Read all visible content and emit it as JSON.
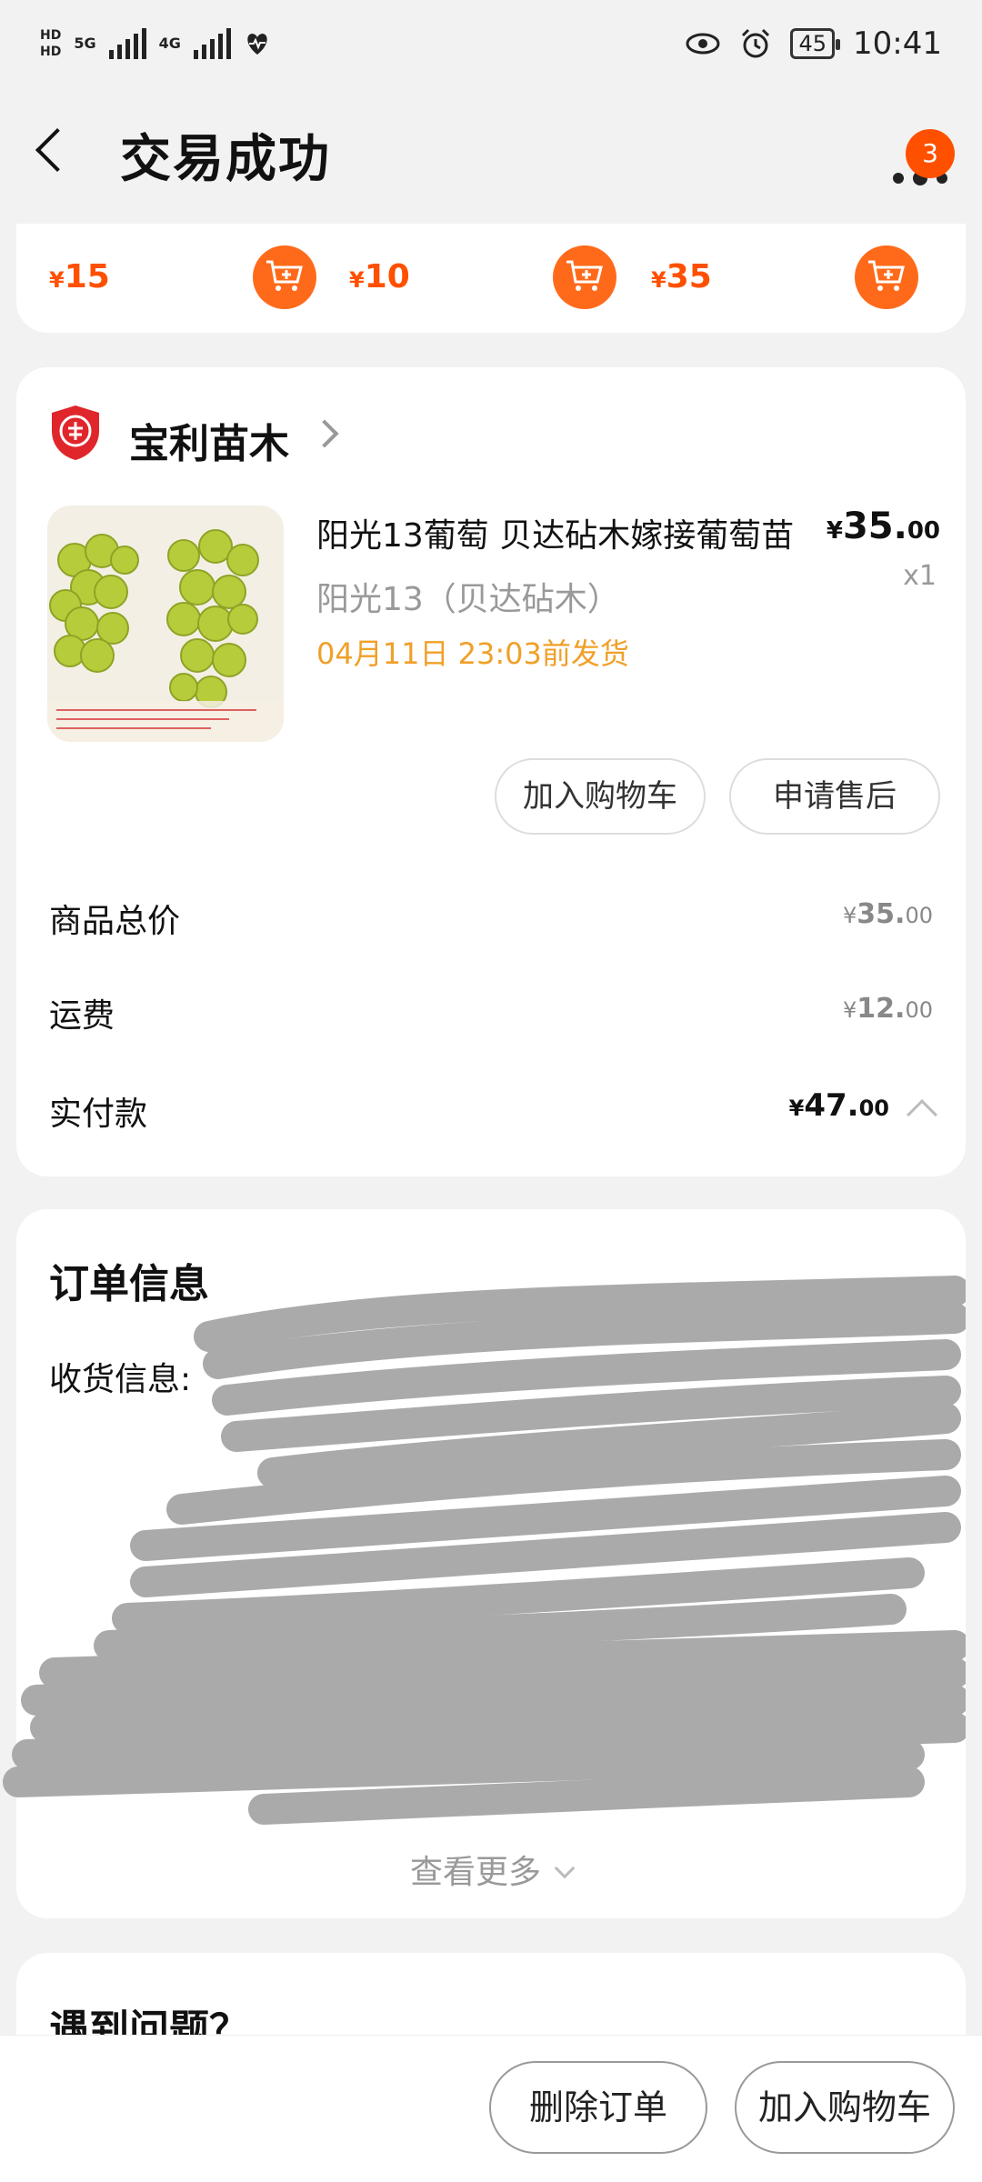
{
  "status_bar": {
    "network_5g": "5G",
    "network_4g": "4G",
    "battery": "45",
    "time": "10:41"
  },
  "header": {
    "title": "交易成功",
    "badge_count": "3"
  },
  "recommendations": [
    {
      "currency": "¥",
      "price": "15"
    },
    {
      "currency": "¥",
      "price": "10"
    },
    {
      "currency": "¥",
      "price": "35"
    }
  ],
  "order": {
    "shop_name": "宝利苗木",
    "product": {
      "title": "阳光13葡萄  贝达砧木嫁接葡萄苗",
      "price_currency": "¥",
      "price_int": "35.",
      "price_dec": "00",
      "quantity": "x1",
      "sku": "阳光13（贝达砧木）",
      "ship_by": "04月11日 23:03前发货"
    },
    "actions": {
      "add_to_cart": "加入购物车",
      "after_sale": "申请售后"
    },
    "summary": {
      "goods_total_label": "商品总价",
      "goods_total_currency": "¥",
      "goods_total_int": "35.",
      "goods_total_dec": "00",
      "shipping_label": "运费",
      "shipping_currency": "¥",
      "shipping_int": "12.",
      "shipping_dec": "00",
      "paid_label": "实付款",
      "paid_currency": "¥",
      "paid_int": "47.",
      "paid_dec": "00"
    }
  },
  "info": {
    "title": "订单信息",
    "receive_label": "收货信息:",
    "see_more": "查看更多"
  },
  "problem": {
    "title": "遇到问题？"
  },
  "bottom": {
    "delete_order": "删除订单",
    "add_to_cart": "加入购物车"
  },
  "colors": {
    "accent": "#ff5000",
    "ship_text": "#f0a028"
  }
}
